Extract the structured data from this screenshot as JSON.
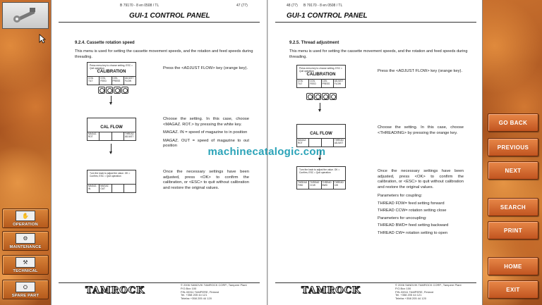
{
  "left_nav": {
    "operation": "OPERATION",
    "maintenance": "MAINTENANCE",
    "technical": "TECHNICAL",
    "spare_part": "SPARE PART"
  },
  "right_nav": {
    "go_back": "GO BACK",
    "previous": "PREVIOUS",
    "next": "NEXT",
    "search": "SEARCH",
    "print": "PRINT",
    "home": "HOME",
    "exit": "EXIT"
  },
  "watermark": "machinecatalogic.com",
  "left_page": {
    "doc_code": "B 79170 - 8 en 0508 / TL",
    "page_no": "47 (77)",
    "header_title": "GUI-1 CONTROL PANEL",
    "section_title": "9.2.4.    Cassette rotation speed",
    "intro": "This menu is used for setting the cassette movement speeds, and the rotation and feed speeds during threading.",
    "lcd1": {
      "small": "Press menu key to choose setting. ESC = Quit operation",
      "title": "CALIBRATION",
      "buttons": [
        "COIL TILT",
        "COIL FEED",
        "COIL PRESS",
        "ADJUST FLOW"
      ]
    },
    "lcd2": {
      "title": "CAL FLOW",
      "buttons": [
        "MAGAZ. ROT",
        "",
        "",
        "THREAD ADJUST"
      ]
    },
    "lcd3": {
      "small": "Turn the knob to adjust the value. OK = Confirm, ESC = Quit operation",
      "buttons": [
        "MAGAZ. IN",
        "MAGAZ. OUT",
        "",
        ""
      ]
    },
    "desc1": "Press the <ADJUST FLOW> key (orange key).",
    "desc2a": "Choose the setting. In this case, choose <MAGAZ. ROT.> by pressing the white key.",
    "desc2b": "MAGAZ. IN = speed of magazine to in position",
    "desc2c": "MAGAZ. OUT = speed of magazine to out position",
    "desc3": "Once the necessary settings have been adjusted, press <OK> to confirm the calibration, or <ESC> to quit without calibration and restore the original values.",
    "logo": "TAMROCK",
    "copyright": [
      "© 2006 SANDVIK TAMROCK CORP., Tampere Plant",
      "P.O.Box 100",
      "FIN-33311 TAMPERE, Finland",
      "Tel. +358 205 44 121",
      "Telefax +358 205 44 120"
    ]
  },
  "right_page": {
    "doc_code": "B 79170 - 8 en 0508 / TL",
    "page_no": "48 (77)",
    "header_title": "GUI-1 CONTROL PANEL",
    "section_title": "9.2.5.    Thread adjustment",
    "intro": "This menu is used for setting the cassette movement speeds, and the rotation and feed speeds during threading.",
    "lcd1": {
      "small": "Press menu key to choose setting. ESC = Quit operation",
      "title": "CALIBRATION",
      "buttons": [
        "COIL TILT",
        "COIL FEED",
        "COIL PRESS",
        "ADJUST FLOW"
      ]
    },
    "lcd2": {
      "title": "CAL FLOW",
      "buttons": [
        "MAGAZ. ROT",
        "",
        "",
        "THREAD ADJUST"
      ]
    },
    "lcd3": {
      "small": "Turn the knob to adjust the value. OK = Confirm, ESC = Quit operation",
      "buttons": [
        "THREAD FWD",
        "THREAD CCW",
        "THREAD BWD",
        "THREAD CW"
      ]
    },
    "desc1": "Press the <ADJUST FLOW> key (orange key).",
    "desc2": "Choose the setting. In this case, choose <THREADING> by pressing the orange key.",
    "desc3": "Once the necessary settings have been adjusted, press <OK> to confirm the calibration, or <ESC> to quit without calibration and restore the original values.",
    "params": [
      "Parameters for coupling:",
      "THREAD FDW= feed setting forward",
      "THREAD CCW= rotation setting close",
      "Parameters for uncoupling:",
      "THREAD BWD= feed setting backward",
      "THREAD CW= rotation setting to open"
    ],
    "logo": "TAMROCK",
    "copyright": [
      "© 2006 SANDVIK TAMROCK CORP., Tampere Plant",
      "P.O.Box 100",
      "FIN-33311 TAMPERE, Finland",
      "Tel. +358 205 44 121",
      "Telefax +358 205 44 120"
    ]
  }
}
